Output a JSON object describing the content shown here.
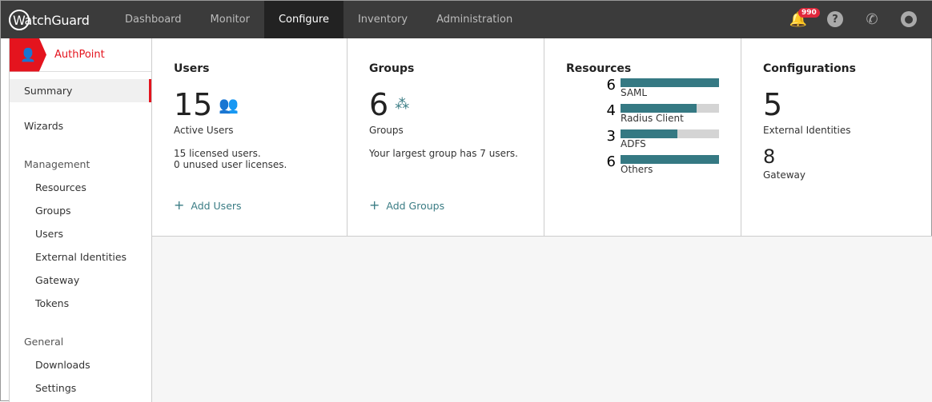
{
  "header": {
    "logo": "WatchGuard",
    "nav": [
      "Dashboard",
      "Monitor",
      "Configure",
      "Inventory",
      "Administration"
    ],
    "active": "Configure",
    "notifications": "990"
  },
  "sidebar": {
    "product": "AuthPoint",
    "summary": "Summary",
    "wizards": "Wizards",
    "management": "Management",
    "management_items": [
      "Resources",
      "Groups",
      "Users",
      "External Identities",
      "Gateway",
      "Tokens"
    ],
    "general": "General",
    "general_items": [
      "Downloads",
      "Settings"
    ]
  },
  "users": {
    "title": "Users",
    "count": "15",
    "label": "Active Users",
    "line1": "15 licensed users.",
    "line2": "0 unused user licenses.",
    "add": "Add Users"
  },
  "groups": {
    "title": "Groups",
    "count": "6",
    "label": "Groups",
    "line1": "Your largest group has 7 users.",
    "add": "Add Groups"
  },
  "resources": {
    "title": "Resources",
    "items": [
      {
        "count": "6",
        "label": "SAML",
        "fill": 1.0
      },
      {
        "count": "4",
        "label": "Radius Client",
        "fill": 0.77
      },
      {
        "count": "3",
        "label": "ADFS",
        "fill": 0.58
      },
      {
        "count": "6",
        "label": "Others",
        "fill": 1.0
      }
    ]
  },
  "configurations": {
    "title": "Configurations",
    "ext_count": "5",
    "ext_label": "External Identities",
    "gw_count": "8",
    "gw_label": "Gateway"
  }
}
